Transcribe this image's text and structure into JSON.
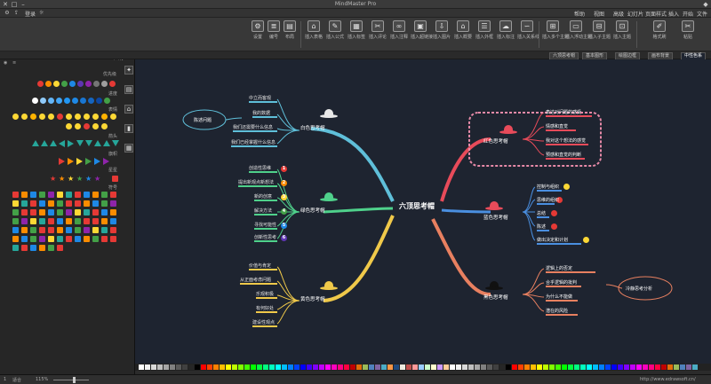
{
  "window": {
    "title": "MindMaster Pro"
  },
  "menubar": {
    "items": [
      "帮助",
      "视图",
      "高级",
      "幻灯片",
      "页面样式",
      "插入",
      "开始",
      "文件"
    ],
    "login": "登录"
  },
  "ribbon": {
    "buttons": [
      "粘贴",
      "格式刷",
      "插入主题",
      "插入子主题",
      "插入浮动主题",
      "插入多个主题",
      "插入关系线",
      "插入标注",
      "插入外框",
      "插入概要",
      "插入图片",
      "插入标签",
      "插入附件",
      "插入超链接",
      "插入注释",
      "插入评论",
      "插入标签",
      "插入公式",
      "插入表格",
      "布局",
      "编号",
      "设置"
    ]
  },
  "tabs": [
    "中性色系",
    "画布背景",
    "绘图边框",
    "基本图形",
    "六顶思考帽"
  ],
  "sidebar": {
    "title": "图标",
    "sections": [
      "优先级",
      "进度",
      "表情",
      "箭头",
      "旗帜",
      "星星",
      "符号"
    ]
  },
  "mindmap": {
    "central": "六顶思考帽",
    "branches": [
      {
        "name": "白色思考帽",
        "topics": [
          "中立而客观",
          "我的数据",
          "我们还需要什么信息",
          "我们已经掌握什么信息"
        ],
        "callout": "陈述问题",
        "color": "#5fbfd9"
      },
      {
        "name": "绿色思考帽",
        "topics": [
          "创造性思维",
          "提出新观点新想法",
          "新的创意",
          "解决方法",
          "寻找可能性",
          "创新性思考"
        ],
        "color": "#4fd18b"
      },
      {
        "name": "黄色思考帽",
        "topics": [
          "价值与肯定",
          "从正面考虑问题",
          "乐观积极",
          "有何好处",
          "建设性观点"
        ],
        "color": "#f0c94a"
      },
      {
        "name": "红色思考帽",
        "topics": [
          "表达对问题的感受",
          "情感和直觉",
          "我对这个想法的感觉",
          "预感和直觉的判断"
        ],
        "color": "#e84b5a"
      },
      {
        "name": "蓝色思考帽",
        "topics": [
          "控制与组织",
          "思维的组织",
          "总结",
          "陈述",
          "做出决定和计划"
        ],
        "color": "#4a8fe0"
      },
      {
        "name": "黑色思考帽",
        "topics": [
          "逻辑上的否定",
          "合乎逻辑的批判",
          "为什么不能做",
          "潜在的风险"
        ],
        "callout": "冷静思考分析",
        "color": "#e88060"
      }
    ],
    "left_callout": "提出问题"
  },
  "statusbar": {
    "url": "http://www.edrawsoft.cn/",
    "zoom": "115%",
    "page": "1",
    "fit": "适合"
  },
  "colors": {
    "canvas": "#1e2430",
    "central_text": "#ffffff"
  }
}
